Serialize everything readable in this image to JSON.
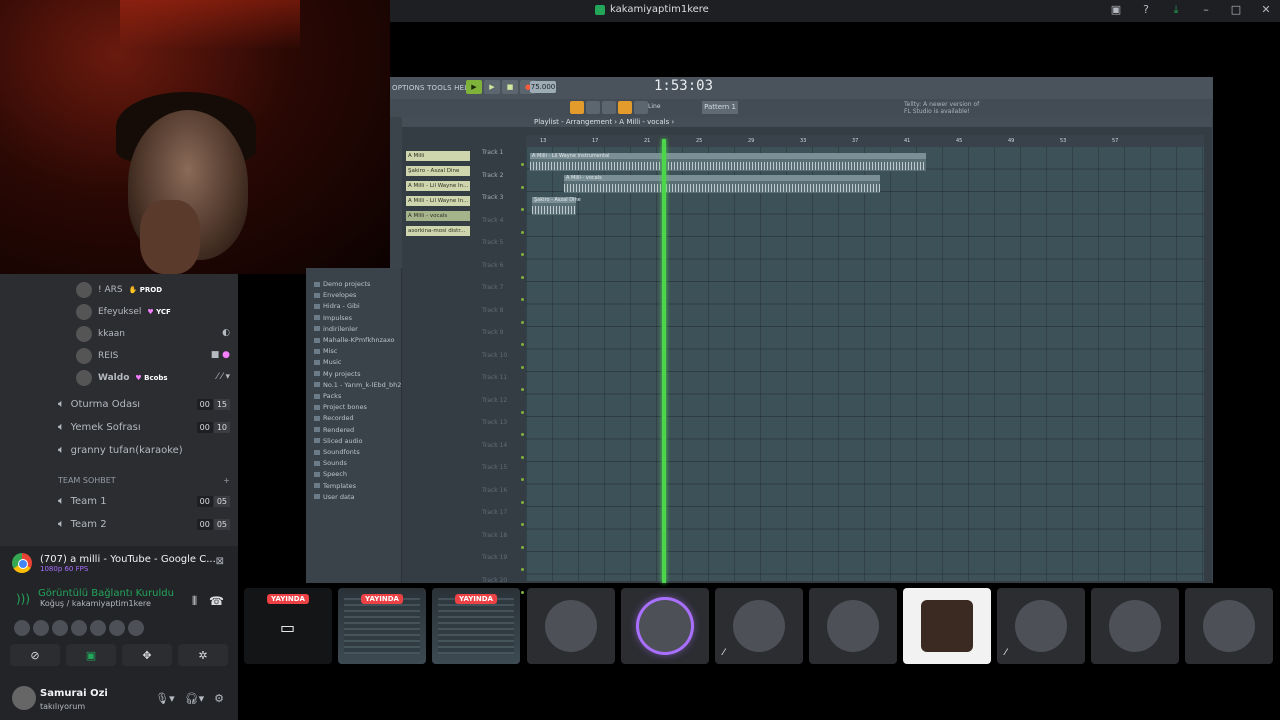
{
  "window": {
    "title": "kakamiyaptim1kere",
    "controls": [
      "monitor-icon",
      "help-icon",
      "download-icon",
      "minimize-icon",
      "maximize-icon",
      "close-icon"
    ]
  },
  "voice_users": [
    {
      "name": "! ARS",
      "tag": "PROD"
    },
    {
      "name": "Efeyuksel",
      "tag": "YCF"
    },
    {
      "name": "kkaan",
      "tag": ""
    },
    {
      "name": "REIS",
      "tag": ""
    },
    {
      "name": "Waldo",
      "tag": "Bcobs"
    }
  ],
  "channels": [
    {
      "name": "Oturma Odası",
      "a": "00",
      "b": "15"
    },
    {
      "name": "Yemek Sofrası",
      "a": "00",
      "b": "10"
    },
    {
      "name": "granny tufan(karaoke)",
      "a": "",
      "b": ""
    }
  ],
  "category": {
    "name": "TEAM SOHBET",
    "add": "+"
  },
  "team_channels": [
    {
      "name": "Team 1",
      "a": "00",
      "b": "05"
    },
    {
      "name": "Team 2",
      "a": "00",
      "b": "05"
    }
  ],
  "stream": {
    "title": "(707) a milli - YouTube - Google C...",
    "quality": "1080p 60 FPS"
  },
  "connection": {
    "status": "Görüntülü Bağlantı Kuruldu",
    "location": "Koğuş / kakamiyaptim1kere"
  },
  "user": {
    "name": "Samurai Ozi",
    "status": "takılıyorum"
  },
  "fl": {
    "menu": "OPTIONS TOOLS HELP",
    "tempo": "75.000",
    "time": "1:53:03",
    "pattern": "Pattern 1",
    "snap": "Line",
    "hint_line1": "Tellty: A newer version of",
    "hint_line2": "FL Studio is available!",
    "playlist_title": "Playlist - Arrangement › A Milli - vocals ›",
    "browser_items": [
      "Demo projects",
      "Envelopes",
      "Hidra - Gibi",
      "Impulses",
      "indirilenler",
      "Mahalle-KPmfkhnzaxo",
      "Misc",
      "Music",
      "My projects",
      "No.1 - Yarım_k-lEbd_bh2Bvo",
      "Packs",
      "Project bones",
      "Recorded",
      "Rendered",
      "Sliced audio",
      "Soundfonts",
      "Sounds",
      "Speech",
      "Templates",
      "User data"
    ],
    "picker": [
      "A Milli",
      "Şakiro - Aszal Dine",
      "A Milli - Lil Wayne In...",
      "A Milli - Lil Wayne In...",
      "A Milli - vocals",
      "asorkina-mosi distr..."
    ],
    "tracks": [
      "Track 1",
      "Track 2",
      "Track 3",
      "Track 4",
      "Track 5",
      "Track 6",
      "Track 7",
      "Track 8",
      "Track 9",
      "Track 10",
      "Track 11",
      "Track 12",
      "Track 13",
      "Track 14",
      "Track 15",
      "Track 16",
      "Track 17",
      "Track 18",
      "Track 19",
      "Track 20"
    ],
    "clips": [
      {
        "label": "A Milli - Lil Wayne Instrumental"
      },
      {
        "label": "A Milli - vocals"
      },
      {
        "label": "Şakiro - Aszal Dine"
      }
    ],
    "ruler": [
      "13",
      "17",
      "21",
      "25",
      "29",
      "33",
      "37",
      "41",
      "45",
      "49",
      "53",
      "57"
    ]
  },
  "tiles": [
    {
      "live": "YAYINDA"
    },
    {
      "live": "YAYINDA"
    },
    {
      "live": "YAYINDA"
    }
  ]
}
